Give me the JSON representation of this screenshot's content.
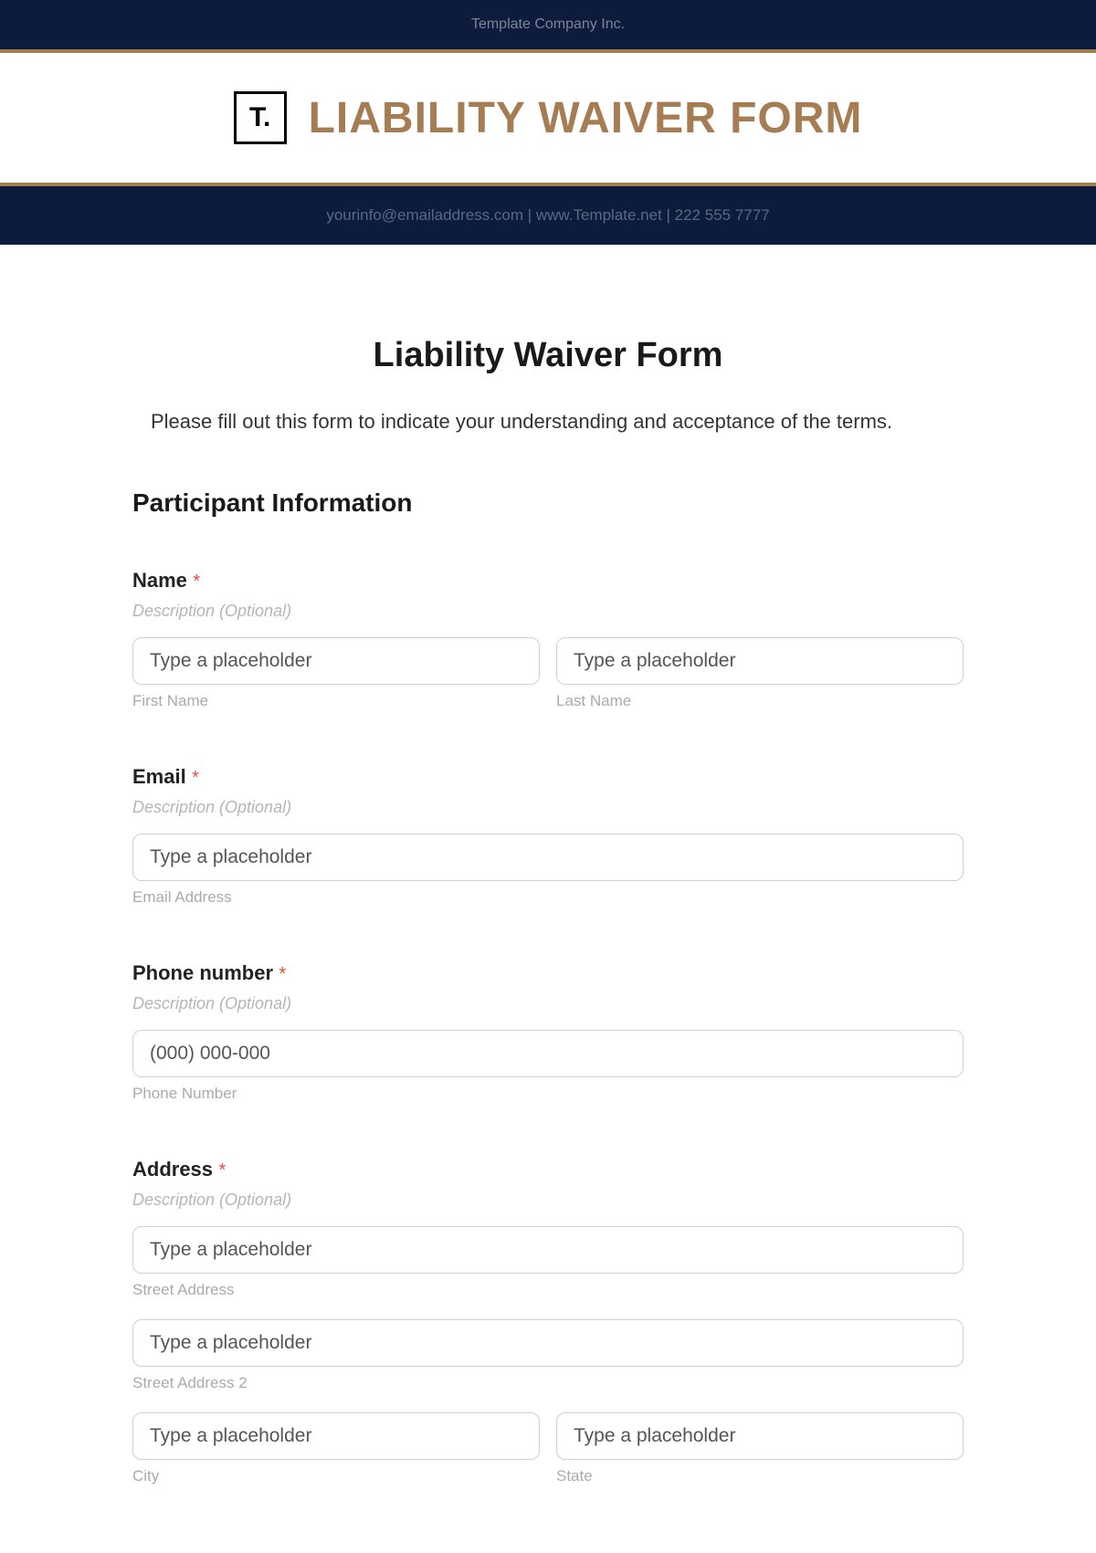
{
  "topBanner": {
    "company": "Template Company Inc."
  },
  "header": {
    "logoText": "T.",
    "title": "LIABILITY WAIVER FORM"
  },
  "contactBanner": {
    "text": "yourinfo@emailaddress.com  |  www.Template.net  |  222 555 7777"
  },
  "form": {
    "title": "Liability Waiver Form",
    "intro": "Please fill out this form to indicate your understanding and acceptance of the terms.",
    "sectionHeading": "Participant Information",
    "name": {
      "label": "Name",
      "description": "Description (Optional)",
      "firstPlaceholder": "Type a placeholder",
      "firstSub": "First Name",
      "lastPlaceholder": "Type a placeholder",
      "lastSub": "Last Name"
    },
    "email": {
      "label": "Email",
      "description": "Description (Optional)",
      "placeholder": "Type a placeholder",
      "sub": "Email Address"
    },
    "phone": {
      "label": "Phone number",
      "description": "Description (Optional)",
      "placeholder": "(000) 000-000",
      "sub": "Phone Number"
    },
    "address": {
      "label": "Address",
      "description": "Description (Optional)",
      "street1Placeholder": "Type a placeholder",
      "street1Sub": "Street Address",
      "street2Placeholder": "Type a placeholder",
      "street2Sub": "Street Address 2",
      "cityPlaceholder": "Type a placeholder",
      "citySub": "City",
      "statePlaceholder": "Type a placeholder",
      "stateSub": "State"
    }
  }
}
